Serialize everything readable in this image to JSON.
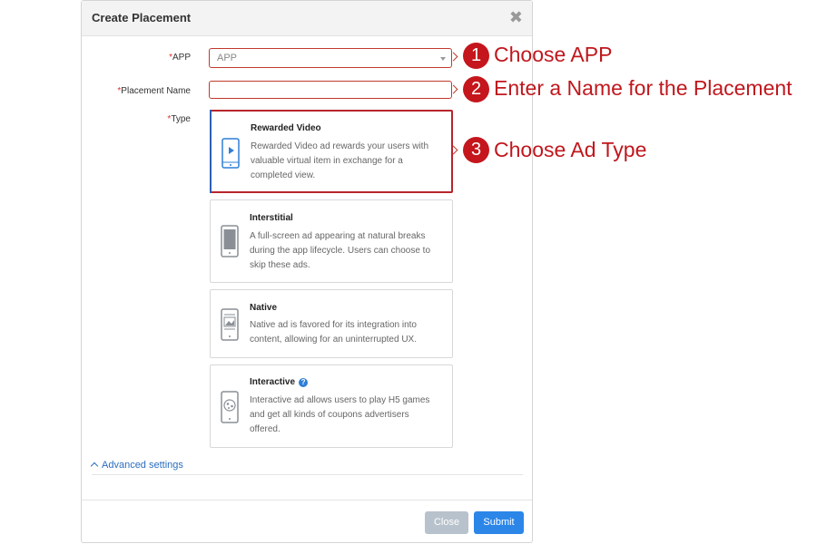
{
  "dialog": {
    "title": "Create Placement",
    "close_glyph": "✖"
  },
  "form": {
    "app": {
      "required": "*",
      "label": "APP",
      "placeholder": "APP"
    },
    "placement_name": {
      "required": "*",
      "label": "Placement Name",
      "value": ""
    },
    "type": {
      "required": "*",
      "label": "Type"
    }
  },
  "ad_types": [
    {
      "title": "Rewarded Video",
      "description": "Rewarded Video ad rewards your users with valuable virtual item in exchange for a completed view.",
      "icon": "phone-play-icon",
      "selected": true
    },
    {
      "title": "Interstitial",
      "description": "A full-screen ad appearing at natural breaks during the app lifecycle. Users can choose to skip these ads.",
      "icon": "phone-fullscreen-icon",
      "selected": false
    },
    {
      "title": "Native",
      "description": "Native ad is favored for its integration into content, allowing for an uninterrupted UX.",
      "icon": "phone-image-icon",
      "selected": false
    },
    {
      "title": "Interactive",
      "description": "Interactive ad allows users to play H5 games and get all kinds of coupons advertisers offered.",
      "icon": "phone-game-icon",
      "selected": false,
      "help": "?"
    }
  ],
  "advanced_settings": {
    "label": "Advanced settings"
  },
  "footer": {
    "close_label": "Close",
    "submit_label": "Submit"
  },
  "annotations": [
    {
      "number": "1",
      "text": "Choose APP"
    },
    {
      "number": "2",
      "text": "Enter a Name for the Placement"
    },
    {
      "number": "3",
      "text": "Choose Ad Type"
    }
  ],
  "colors": {
    "accent_red": "#c4161c",
    "primary_blue": "#2b86e8",
    "link_blue": "#2a6ebd",
    "disabled_gray": "#b8c2cc"
  }
}
